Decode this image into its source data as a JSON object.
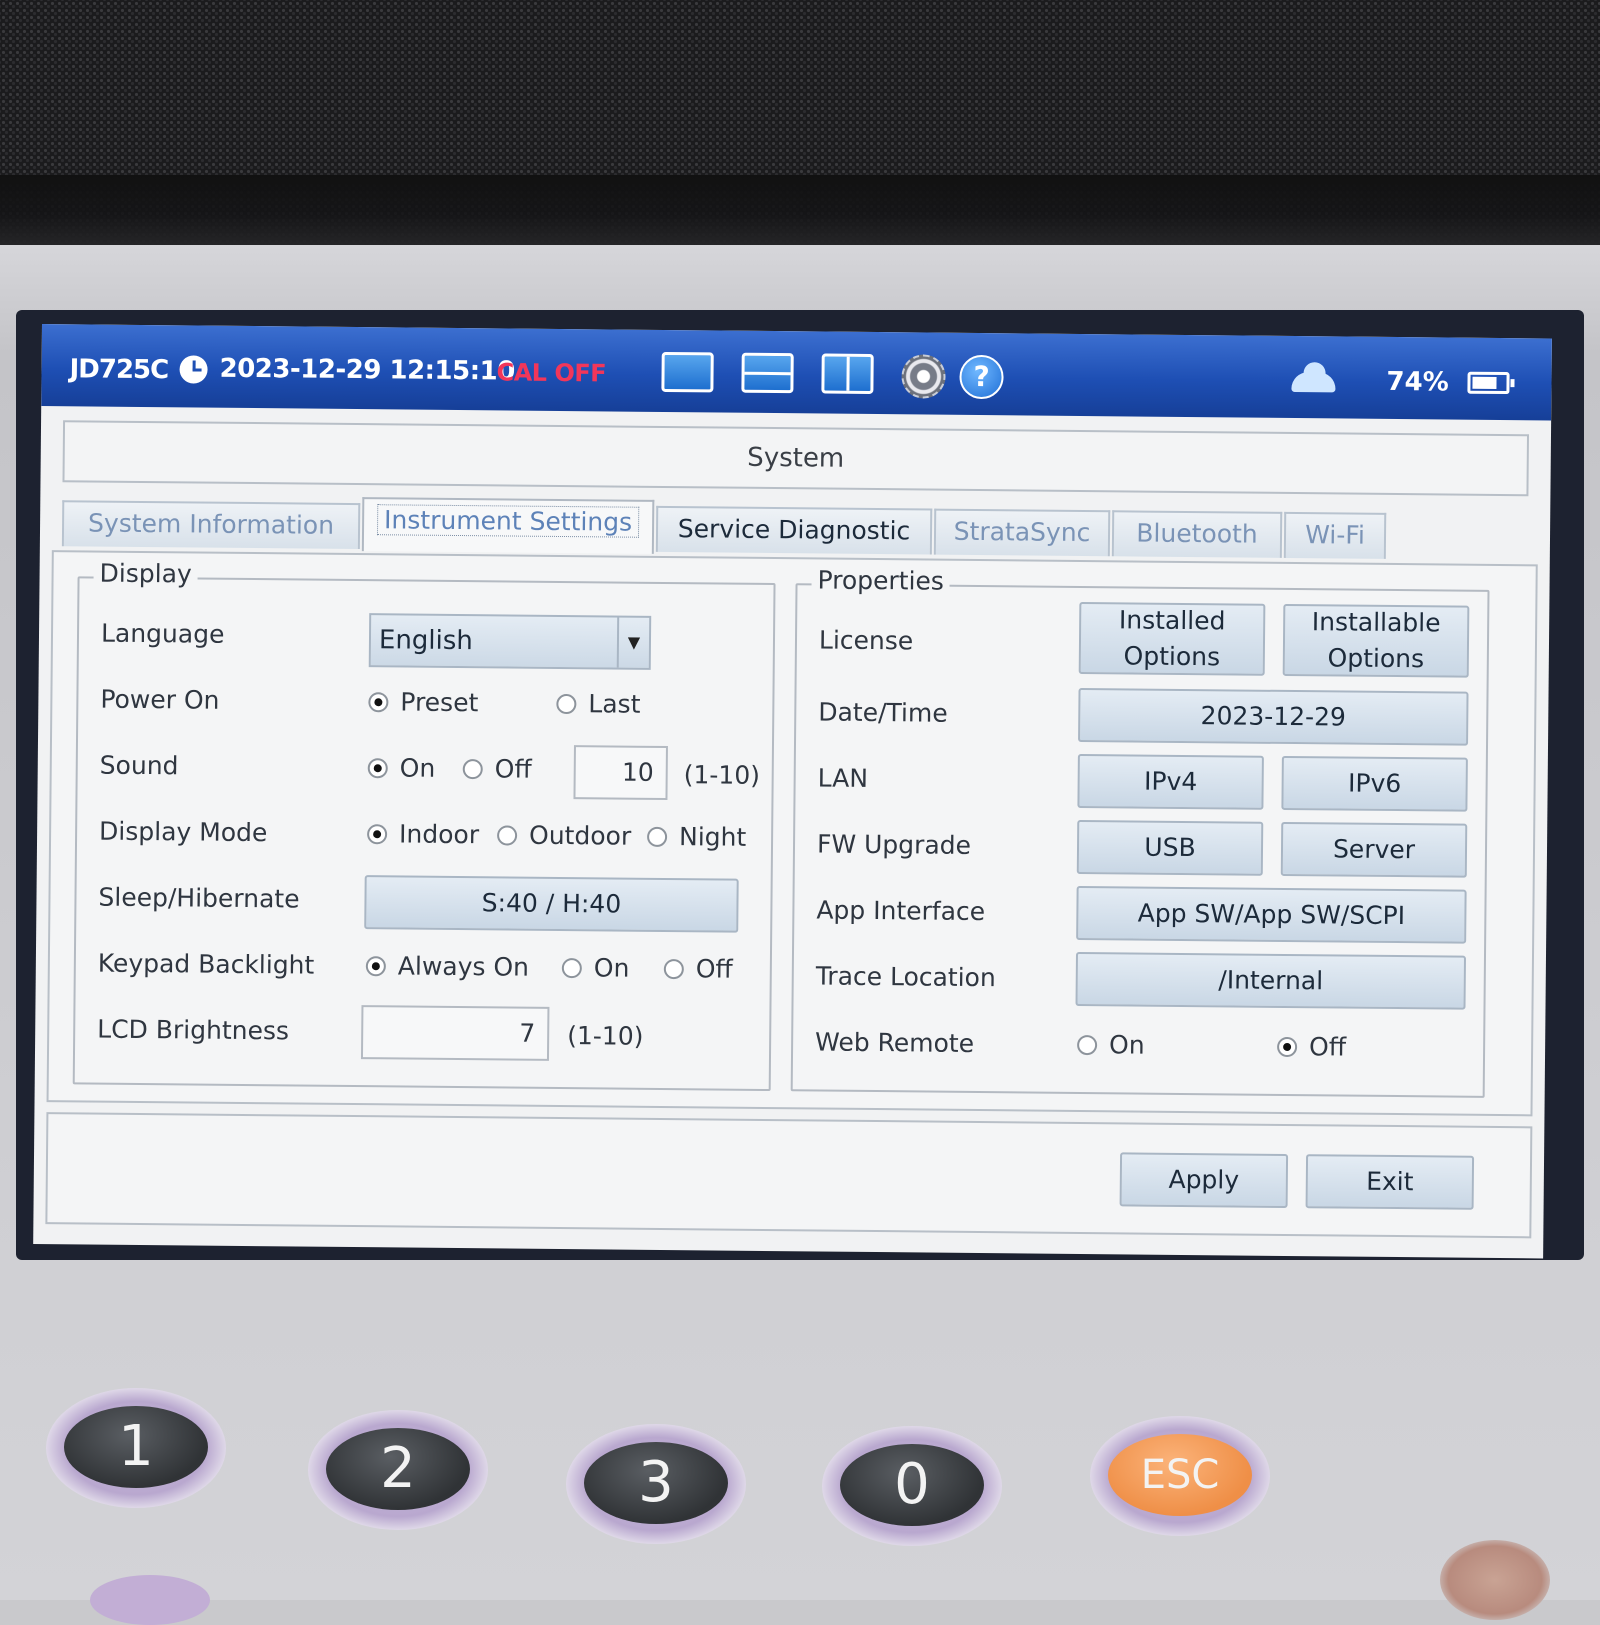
{
  "titlebar": {
    "model": "JD725C",
    "datetime": "2023-12-29 12:15:10",
    "cal_status": "CAL OFF",
    "cal_color": "#f2365a",
    "battery_percent": "74%",
    "battery_level": 0.74,
    "icons": [
      "single-view-icon",
      "horizontal-split-icon",
      "vertical-split-icon",
      "gear-icon",
      "help-icon",
      "cloud-icon",
      "battery-icon"
    ],
    "help_glyph": "?"
  },
  "header": {
    "title": "System"
  },
  "tabs": [
    {
      "label": "System Information",
      "active": false
    },
    {
      "label": "Instrument Settings",
      "active": true
    },
    {
      "label": "Service Diagnostic",
      "active": false
    },
    {
      "label": "StrataSync",
      "active": false
    },
    {
      "label": "Bluetooth",
      "active": false
    },
    {
      "label": "Wi-Fi",
      "active": false
    }
  ],
  "display": {
    "legend": "Display",
    "language": {
      "label": "Language",
      "value": "English"
    },
    "power_on": {
      "label": "Power On",
      "options": [
        "Preset",
        "Last"
      ],
      "selected": "Preset"
    },
    "sound": {
      "label": "Sound",
      "options": [
        "On",
        "Off"
      ],
      "selected": "On",
      "volume": "10",
      "range": "(1-10)"
    },
    "display_mode": {
      "label": "Display Mode",
      "options": [
        "Indoor",
        "Outdoor",
        "Night"
      ],
      "selected": "Indoor"
    },
    "sleep": {
      "label": "Sleep/Hibernate",
      "value": "S:40 / H:40"
    },
    "keypad_backlight": {
      "label": "Keypad Backlight",
      "options": [
        "Always On",
        "On",
        "Off"
      ],
      "selected": "Always On"
    },
    "lcd_brightness": {
      "label": "LCD Brightness",
      "value": "7",
      "range": "(1-10)"
    }
  },
  "properties": {
    "legend": "Properties",
    "license": {
      "label": "License",
      "buttons": [
        "Installed Options",
        "Installable Options"
      ]
    },
    "datetime": {
      "label": "Date/Time",
      "value": "2023-12-29"
    },
    "lan": {
      "label": "LAN",
      "buttons": [
        "IPv4",
        "IPv6"
      ]
    },
    "fw_upgrade": {
      "label": "FW Upgrade",
      "buttons": [
        "USB",
        "Server"
      ]
    },
    "app_interface": {
      "label": "App Interface",
      "value": "App SW/App SW/SCPI"
    },
    "trace_location": {
      "label": "Trace Location",
      "value": "/Internal"
    },
    "web_remote": {
      "label": "Web Remote",
      "options": [
        "On",
        "Off"
      ],
      "selected": "Off"
    }
  },
  "footer": {
    "apply": "Apply",
    "exit": "Exit"
  },
  "keypad": {
    "keys": [
      "1",
      "2",
      "3",
      "0",
      "ESC"
    ],
    "esc_color": "#ef8f47"
  }
}
